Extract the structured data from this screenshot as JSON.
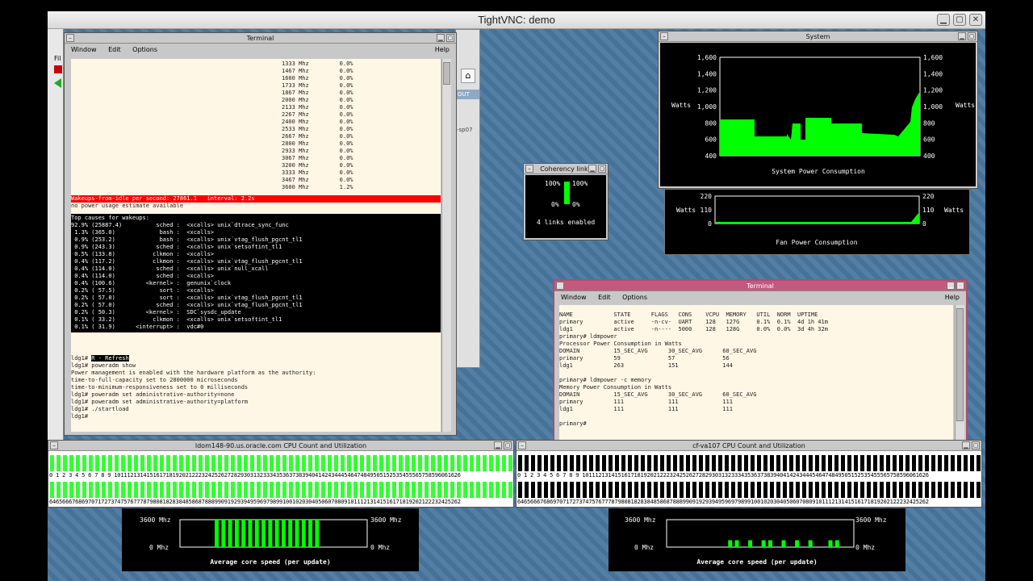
{
  "vnc": {
    "title": "TightVNC: demo",
    "btn_min": "▁",
    "btn_max": "▢",
    "btn_close": "✕"
  },
  "left_strip": {
    "fragment1": "Fil",
    "fragment2": "OUT",
    "fragment3": "-sp07"
  },
  "terminal1": {
    "title": "Terminal",
    "menu": {
      "window": "Window",
      "edit": "Edit",
      "options": "Options",
      "help": "Help"
    },
    "freq_lines": [
      "1333 Mhz         0.0%",
      "1467 Mhz         0.0%",
      "1600 Mhz         0.0%",
      "1733 Mhz         0.0%",
      "1867 Mhz         0.0%",
      "2000 Mhz         0.0%",
      "2133 Mhz         0.0%",
      "2267 Mhz         0.0%",
      "2400 Mhz         0.0%",
      "2533 Mhz         0.0%",
      "2667 Mhz         0.0%",
      "2800 Mhz         0.0%",
      "2933 Mhz         0.0%",
      "3067 Mhz         0.0%",
      "3200 Mhz         0.0%",
      "3333 Mhz         0.0%",
      "3467 Mhz         0.0%",
      "3600 Mhz         1.2%"
    ],
    "wakeups": "Wakeups-from-idle per second: 27861.1   interval: 2.2s",
    "no_power": "no power usage estimate available",
    "top_causes_header": "Top causes for wakeups:",
    "top_causes": [
      "92.9% (25887.4)          sched :  <xcalls> unix`dtrace_sync_func",
      " 1.3% (365.0)             bash :  <xcalls>",
      " 0.9% (253.2)             bash :  <xcalls> unix`vtag_flush_pgcnt_tl1",
      " 0.9% (243.3)            sched :  <xcalls> unix`setsoftint_tl1",
      " 0.5% (133.8)           clkmon :  <xcalls>",
      " 0.4% (117.2)           clkmon :  <xcalls> unix`vtag_flush_pgcnt_tl1",
      " 0.4% (114.0)            sched :  <xcalls> unix`null_xcall",
      " 0.4% (114.0)            sched :  <xcalls>",
      " 0.4% (100.6)         <kernel> :  genunix`clock",
      " 0.2% ( 57.5)             sort :  <xcalls>",
      " 0.2% ( 57.0)             sort :  <xcalls> unix`vtag_flush_pgcnt_tl1",
      " 0.2% ( 57.0)            sched :  <xcalls> unix`vtag_flush_pgcnt_tl1",
      " 0.2% ( 50.3)         <kernel> :  SDC`sysdc_update",
      " 0.1% ( 33.2)           clkmon :  <xcalls> unix`setsoftint_tl1",
      " 0.1% ( 31.9)      <interrupt> :  vdc#0"
    ],
    "refresh_prefix": "ldg1# ",
    "refresh_key": "R - Refresh",
    "shell_lines": [
      "ldg1# poweradm show",
      "Power management is enabled with the hardware platform as the authority:",
      "time-to-full-capacity set to 2800000 microseconds",
      "time-to-minimum-responsiveness set to 0 milliseconds",
      "ldg1# poweradm set administrative-authority=none",
      "ldg1# poweradm set administrative-authority=platform",
      "ldg1# ./startload",
      "ldg1# "
    ]
  },
  "system_win": {
    "title": "System",
    "left_ticks": [
      "1,600",
      "1,400",
      "1,200",
      "1,000",
      "800",
      "600",
      "400"
    ],
    "right_ticks": [
      "1,600",
      "1,400",
      "1,200",
      "1,000",
      "800",
      "600",
      "400"
    ],
    "watts_left": "Watts",
    "watts_right": "Watts",
    "caption": "System Power Consumption",
    "fan_ticks_left": [
      "220",
      "110",
      "0"
    ],
    "fan_ticks_right": [
      "220",
      "110",
      "0"
    ],
    "fan_watts_left": "Watts",
    "fan_watts_right": "Watts",
    "fan_caption": "Fan Power Consumption"
  },
  "coherency": {
    "title": "Coherency links",
    "left_top": "100%",
    "right_top": "100%",
    "left_bot": "0%",
    "right_bot": "0%",
    "status": "4 links enabled"
  },
  "terminal2": {
    "title": "Terminal",
    "menu": {
      "window": "Window",
      "edit": "Edit",
      "options": "Options",
      "help": "Help"
    },
    "lines": [
      "NAME            STATE      FLAGS   CONS    VCPU  MEMORY   UTIL  NORM  UPTIME",
      "primary         active     -n-cv-  UART    128   127G     0.1%  0.1%  4d 1h 41m",
      "ldg1            active     -n----  5000    128   128G     0.0%  0.0%  3d 4h 32m",
      "primary# ldmpower",
      "Processor Power Consumption in Watts",
      "DOMAIN          15_SEC_AVG      30_SEC_AVG      60_SEC_AVG",
      "primary         59              57              56",
      "ldg1            263             151             144",
      "",
      "primary# ldmpower -c memory",
      "Memory Power Consumption in Watts",
      "DOMAIN          15_SEC_AVG      30_SEC_AVG      60_SEC_AVG",
      "primary         111             111             111",
      "ldg1            111             111             111",
      "",
      "primary# "
    ]
  },
  "cpu_left": {
    "title": "ldom148-90.us.oracle.com CPU Count and Utilization",
    "nums_top": "0 1 2 3 4 5 6 7 8 9 10111213141516171819202122232425262728293031323334353637383940414243444546474849505152535455565758596061626",
    "nums_bottom": "6465666768697071727374757677787980818283848586878889909192939495969798991001020304050607080910111213141516171819202122232425262",
    "color": "#33ff33"
  },
  "cpu_right": {
    "title": "cf-va107 CPU Count and Utilization",
    "nums_top": "0 1 2 3 4 5 6 7 8 9 10111213141516171819202122232425262728293031323334353637383940414243444546474849505152535455565758596061626",
    "nums_bottom": "6465666768697071727374757677787980818283848586878889909192939495969798991001020304050607080910111213141516171819202122232425262",
    "color": "#000000"
  },
  "speed_left": {
    "top_left": "3600 Mhz",
    "top_right": "3600 Mhz",
    "bot_left": "0 Mhz",
    "bot_right": "0 Mhz",
    "caption": "Average core speed (per update)"
  },
  "speed_right": {
    "top_left": "3600 Mhz",
    "top_right": "3600 Mhz",
    "bot_left": "0 Mhz",
    "bot_right": "0 Mhz",
    "caption": "Average core speed (per update)"
  },
  "colors": {
    "green": "#00ff00",
    "red": "#ff0000",
    "terminal_bg": "#fff7e6",
    "desktop": "#4a78a0"
  }
}
